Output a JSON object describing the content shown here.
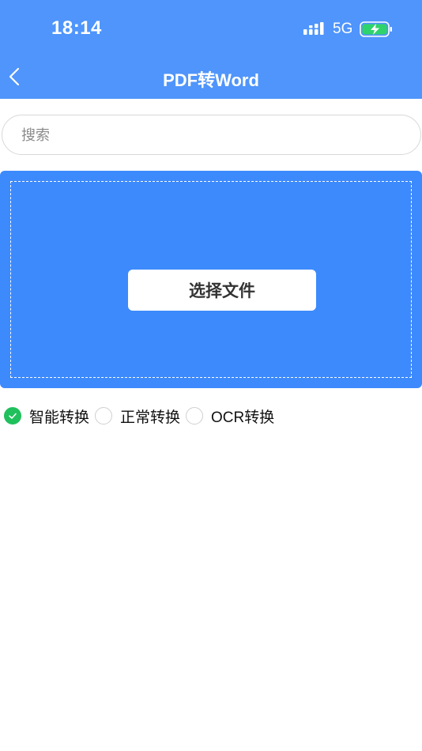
{
  "status_bar": {
    "time": "18:14",
    "network": "5G"
  },
  "nav": {
    "title": "PDF转Word"
  },
  "search": {
    "placeholder": "搜索",
    "value": ""
  },
  "upload": {
    "button_label": "选择文件"
  },
  "conversion_options": [
    {
      "label": "智能转换",
      "selected": true
    },
    {
      "label": "正常转换",
      "selected": false
    },
    {
      "label": "OCR转换",
      "selected": false
    }
  ],
  "colors": {
    "header": "#4f95fb",
    "upload_area": "#3d8afc",
    "selected": "#20c05c"
  },
  "icons": {
    "back": "chevron-left-icon",
    "signal": "signal-icon",
    "battery": "battery-charging-icon",
    "check": "checkmark-icon"
  }
}
